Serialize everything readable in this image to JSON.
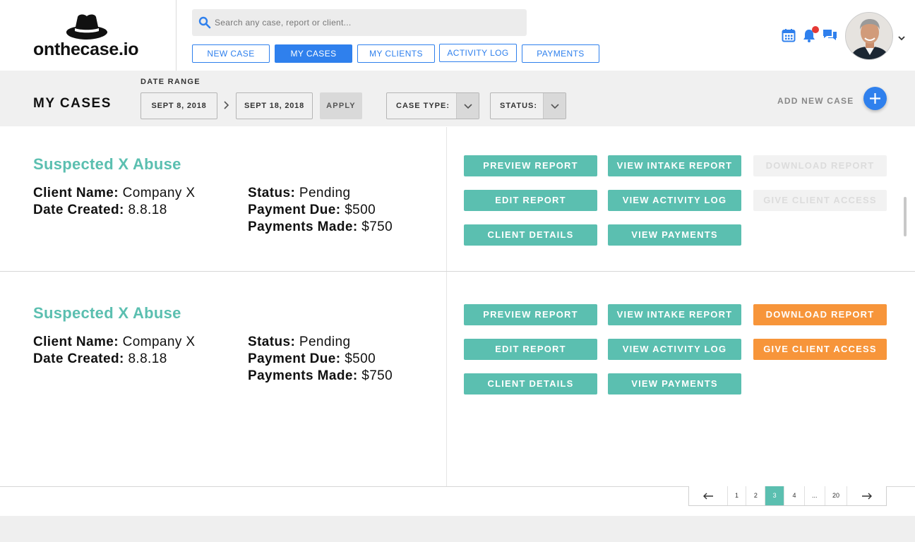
{
  "app": {
    "logo_text": "onthecase.io"
  },
  "search": {
    "placeholder": "Search any case, report or client..."
  },
  "nav": {
    "items": [
      {
        "label": "NEW CASE"
      },
      {
        "label": "MY CASES"
      },
      {
        "label": "MY CLIENTS"
      },
      {
        "label": "ACTIVITY LOG"
      },
      {
        "label": "PAYMENTS"
      }
    ],
    "active": "MY CASES"
  },
  "icons": {
    "calendar": "calendar-icon",
    "notifications": "bell-icon",
    "messages": "chat-icon",
    "account_menu": "chevron-down-icon"
  },
  "toolbar": {
    "title": "MY CASES",
    "date_range_label": "DATE RANGE",
    "start_date": "SEPT 8, 2018",
    "end_date": "SEPT 18, 2018",
    "apply_label": "APPLY",
    "case_type_label": "CASE TYPE:",
    "status_label": "STATUS:",
    "add_new_case_label": "ADD NEW CASE"
  },
  "cases": [
    {
      "title": "Suspected X Abuse",
      "client_name_label": "Client Name:",
      "client_name": "Company X",
      "date_created_label": "Date Created:",
      "date_created": "8.8.18",
      "status_label": "Status:",
      "status": "Pending",
      "payment_due_label": "Payment Due:",
      "payment_due": "$500",
      "payments_made_label": "Payments Made:",
      "payments_made": "$750",
      "buttons": {
        "preview_report": "PREVIEW REPORT",
        "view_intake_report": "VIEW INTAKE REPORT",
        "download_report": "DOWNLOAD REPORT",
        "edit_report": "EDIT REPORT",
        "view_activity_log": "VIEW ACTIVITY LOG",
        "give_client_access": "GIVE CLIENT ACCESS",
        "client_details": "CLIENT DETAILS",
        "view_payments": "VIEW PAYMENTS"
      },
      "report_actions_enabled": false
    },
    {
      "title": "Suspected X Abuse",
      "client_name_label": "Client Name:",
      "client_name": "Company X",
      "date_created_label": "Date Created:",
      "date_created": "8.8.18",
      "status_label": "Status:",
      "status": "Pending",
      "payment_due_label": "Payment Due:",
      "payment_due": "$500",
      "payments_made_label": "Payments Made:",
      "payments_made": "$750",
      "buttons": {
        "preview_report": "PREVIEW REPORT",
        "view_intake_report": "VIEW INTAKE REPORT",
        "download_report": "DOWNLOAD REPORT",
        "edit_report": "EDIT REPORT",
        "view_activity_log": "VIEW ACTIVITY LOG",
        "give_client_access": "GIVE CLIENT ACCESS",
        "client_details": "CLIENT DETAILS",
        "view_payments": "VIEW PAYMENTS"
      },
      "report_actions_enabled": true
    }
  ],
  "pagination": {
    "pages": [
      "1",
      "2",
      "3",
      "4",
      "...",
      "20"
    ],
    "current": "3"
  },
  "colors": {
    "primary": "#2f80ed",
    "accent_teal": "#5bbfb0",
    "accent_orange": "#f7953a",
    "notification_dot": "#e53935"
  }
}
